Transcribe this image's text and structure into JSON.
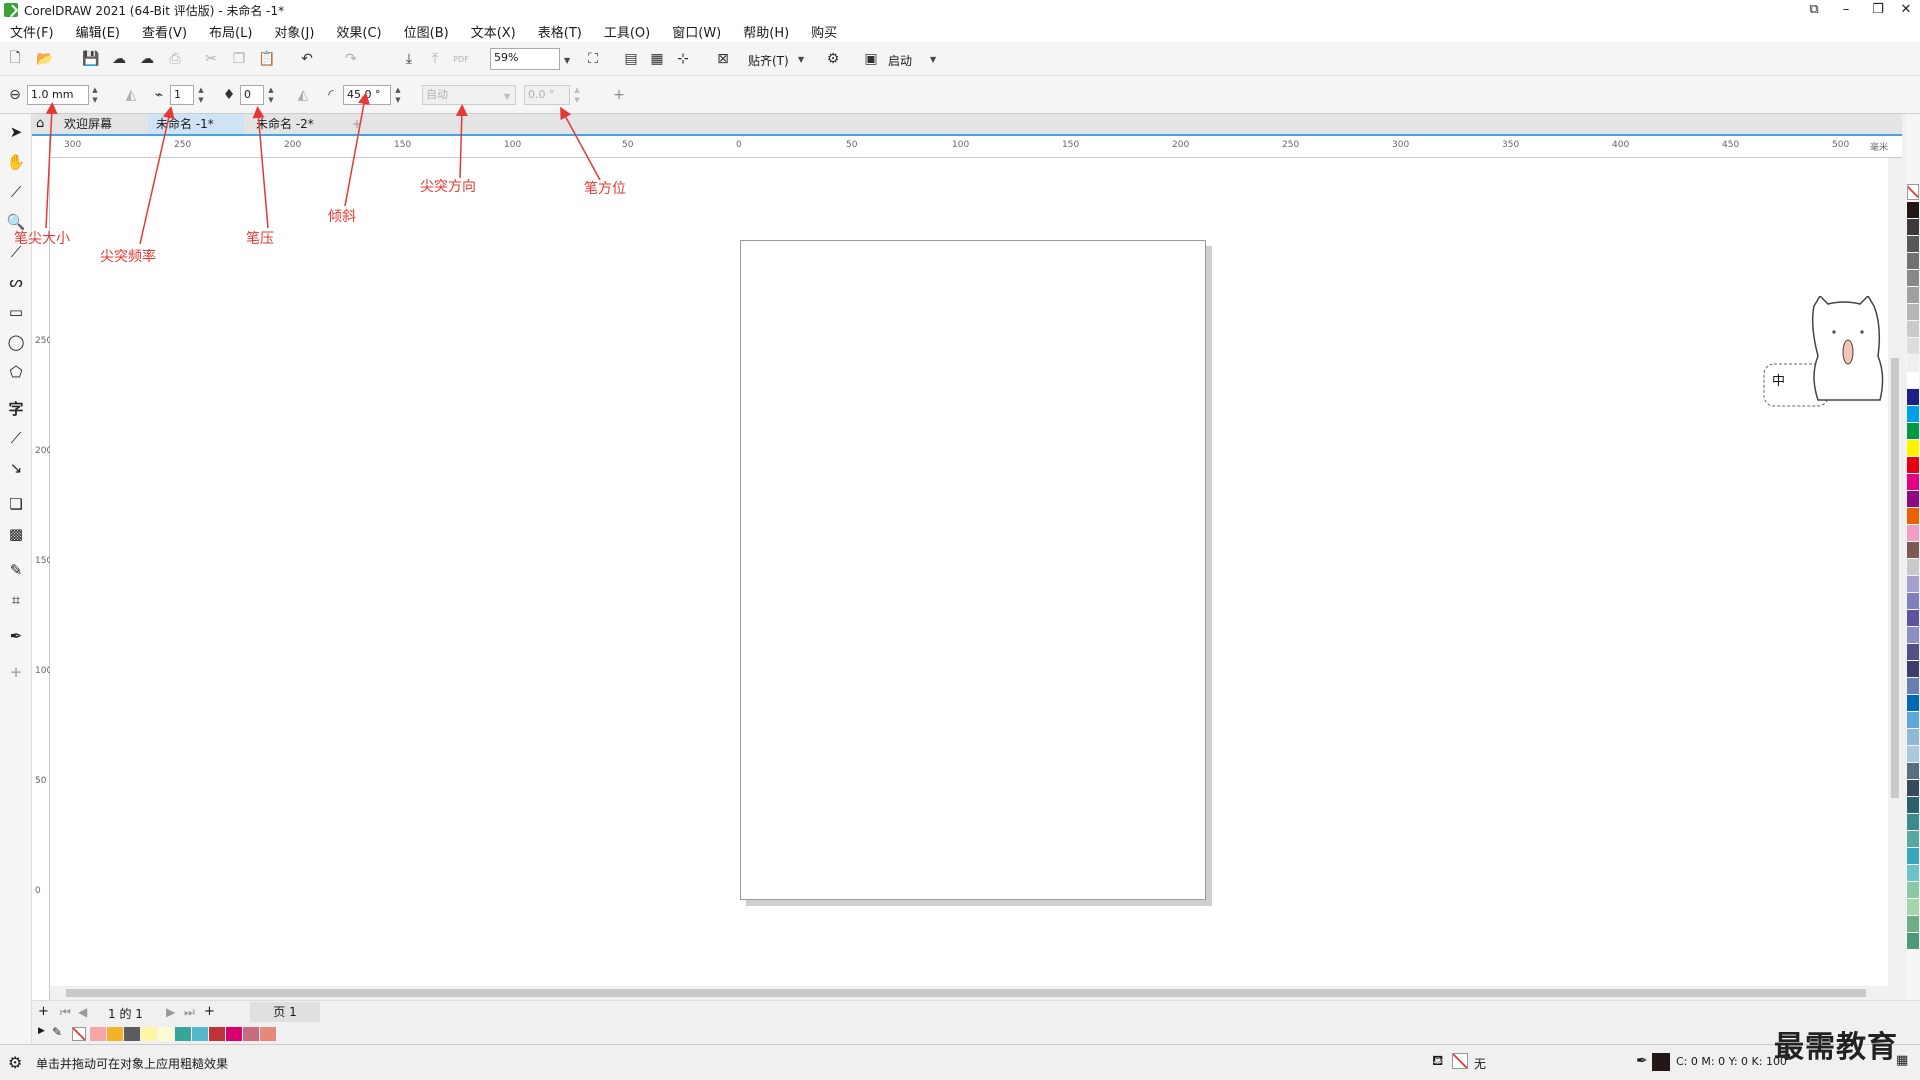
{
  "window": {
    "title": "CorelDRAW 2021 (64-Bit 评估版) - 未命名 -1*"
  },
  "menu": [
    "文件(F)",
    "编辑(E)",
    "查看(V)",
    "布局(L)",
    "对象(J)",
    "效果(C)",
    "位图(B)",
    "文本(X)",
    "表格(T)",
    "工具(O)",
    "窗口(W)",
    "帮助(H)",
    "购买"
  ],
  "toolbar": {
    "zoom": "59%",
    "snap_label": "贴齐(T)",
    "launch_label": "启动"
  },
  "property_bar": {
    "nib_size": "1.0 mm",
    "nib_frequency": "1",
    "pen_pressure": "0",
    "tilt": "45.0 °",
    "bearing_mode": "自动",
    "bearing": "0.0 °"
  },
  "tabs": {
    "welcome": "欢迎屏幕",
    "doc1": "未命名 -1*",
    "doc2": "未命名 -2*"
  },
  "ruler": {
    "h_ticks": [
      "300",
      "250",
      "200",
      "150",
      "100",
      "50",
      "0",
      "50",
      "100",
      "150",
      "200",
      "250",
      "300",
      "350",
      "400",
      "450",
      "500"
    ],
    "h_unit": "毫米",
    "v_ticks": [
      "250",
      "200",
      "150",
      "100",
      "50",
      "0"
    ]
  },
  "pagebar": {
    "position": "1 的 1",
    "page_tab": "页 1"
  },
  "status": {
    "hint": "单击并拖动可在对象上应用粗糙效果",
    "fill": "无",
    "color_readout": "C: 0 M: 0 Y: 0 K: 100"
  },
  "annotations": {
    "nib_size": "笔尖大小",
    "nib_frequency": "尖突频率",
    "pressure": "笔压",
    "tilt": "倾斜",
    "tip_direction": "尖突方向",
    "bearing": "笔方位"
  },
  "overlay": {
    "ime": "中",
    "watermark": "最需教育"
  },
  "colors": {
    "annotation": "#e53935",
    "tab_accent": "#4aa3df",
    "palette": [
      "#231815",
      "#3e3a39",
      "#595757",
      "#727171",
      "#898989",
      "#9fa0a0",
      "#b5b5b6",
      "#c9caca",
      "#dcdddd",
      "#efefef",
      "#ffffff",
      "#1d2088",
      "#00a0e9",
      "#009944",
      "#fff100",
      "#e60012",
      "#e4007f",
      "#920783",
      "#eb6100",
      "#f19ec2",
      "#7d5a50",
      "#c8c9ca",
      "#a4a0cf",
      "#7f7fbf",
      "#5f52a0",
      "#8c8fc5",
      "#554f87",
      "#3c3c6d",
      "#6a7fb1",
      "#0068b7",
      "#5ea7d9",
      "#8fb8d4",
      "#aac9dc",
      "#596f80",
      "#354b5c",
      "#2a5f6b",
      "#3c8a8c",
      "#59a8a1",
      "#3aa6b9",
      "#6cc2c9",
      "#88c8a5",
      "#a5d4ad",
      "#6fae85",
      "#4c9a7a"
    ],
    "doc_palette": [
      "#f4a7a5",
      "#f6b12a",
      "#5c5c5c",
      "#fff5a5",
      "#fff9d6",
      "#36a69a",
      "#55b8c8",
      "#bf3239",
      "#d6006f",
      "#c96a7f",
      "#e58a7a"
    ]
  }
}
